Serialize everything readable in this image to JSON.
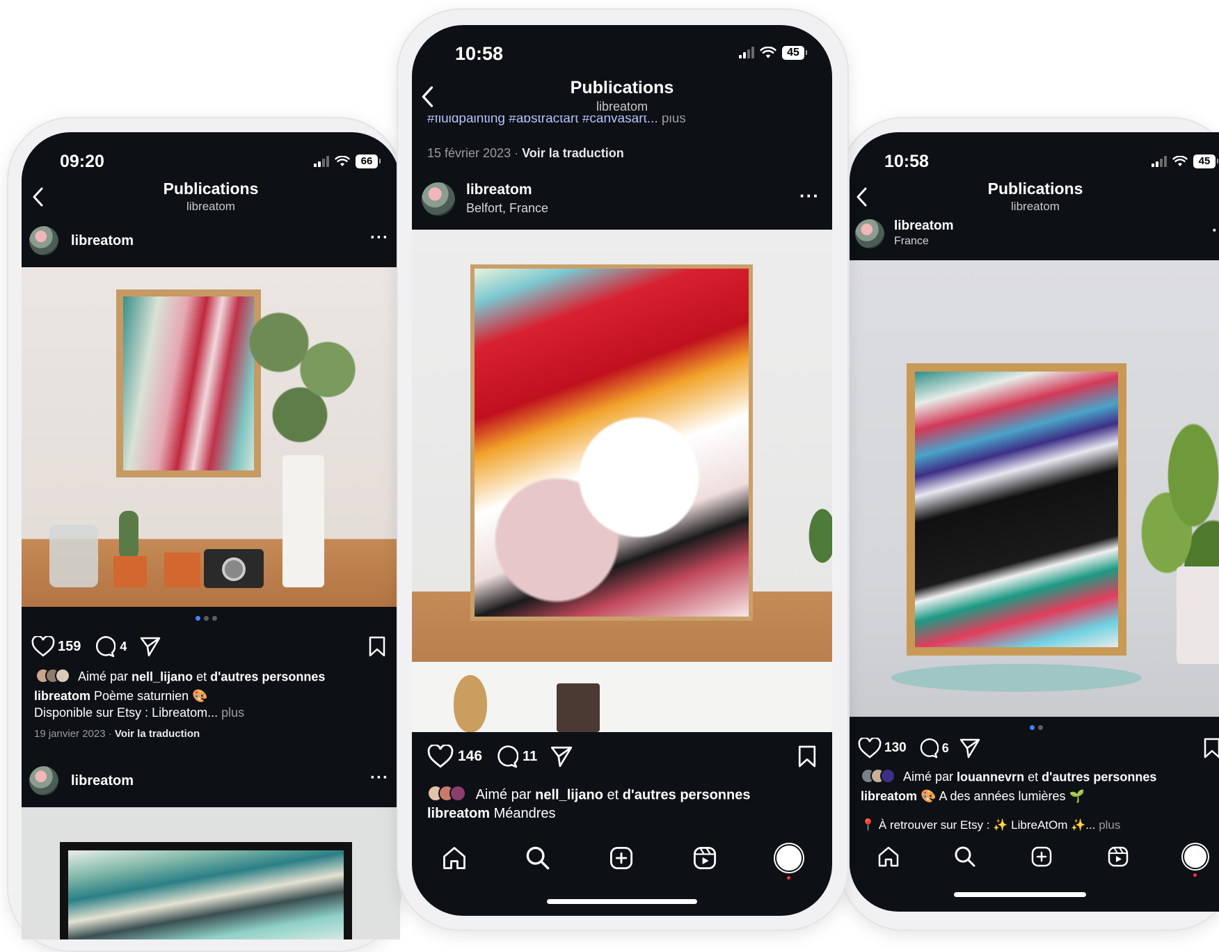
{
  "phone_left": {
    "time": "09:20",
    "battery": "66",
    "header_title": "Publications",
    "header_subtitle": "libreatom",
    "username": "libreatom",
    "likes": "159",
    "comments": "4",
    "liked_by_prefix": "Aimé par ",
    "liked_by_user": "nell_lijano",
    "liked_by_mid": " et ",
    "liked_by_rest": "d'autres personnes",
    "caption_user": "libreatom",
    "caption_text": " Poème saturnien 🎨",
    "caption_line2": "Disponible sur Etsy : Libreatom...",
    "more": " plus",
    "date": "19 janvier 2023",
    "sep": " · ",
    "translate": "Voir la traduction",
    "next_username": "libreatom"
  },
  "phone_center": {
    "time": "10:58",
    "battery": "45",
    "header_title": "Publications",
    "header_subtitle": "libreatom",
    "hashtags": "#fluidpainting #abstractart #canvasart...",
    "hashtags_more": " plus",
    "date": "15 février 2023",
    "sep": " · ",
    "translate": "Voir la traduction",
    "username": "libreatom",
    "location": "Belfort, France",
    "likes": "146",
    "comments": "11",
    "liked_by_prefix": "Aimé par ",
    "liked_by_user": "nell_lijano",
    "liked_by_mid": " et ",
    "liked_by_rest": "d'autres personnes",
    "caption_user": "libreatom",
    "caption_text": " Méandres"
  },
  "phone_right": {
    "time": "10:58",
    "battery": "45",
    "header_title": "Publications",
    "header_subtitle": "libreatom",
    "username": "libreatom",
    "location": "France",
    "likes": "130",
    "comments": "6",
    "liked_by_prefix": "Aimé par ",
    "liked_by_user": "louannevrn",
    "liked_by_mid": " et ",
    "liked_by_rest": "d'autres personnes",
    "caption_user": "libreatom",
    "caption_text": " 🎨 A des années lumières 🌱",
    "caption_line2": "📍 À retrouver sur Etsy : ✨ LibreAtOm ✨...",
    "more": " plus"
  },
  "icons": [
    "back-chevron-icon",
    "heart-icon",
    "comment-icon",
    "share-icon",
    "bookmark-icon",
    "more-icon",
    "home-icon",
    "search-icon",
    "create-icon",
    "reels-icon",
    "profile-icon"
  ],
  "colors": {
    "screen_bg": "#0d1014",
    "phone_frame": "#f1f1f3",
    "hashtag": "#b8c2ff",
    "muted": "#9c9c9c"
  }
}
